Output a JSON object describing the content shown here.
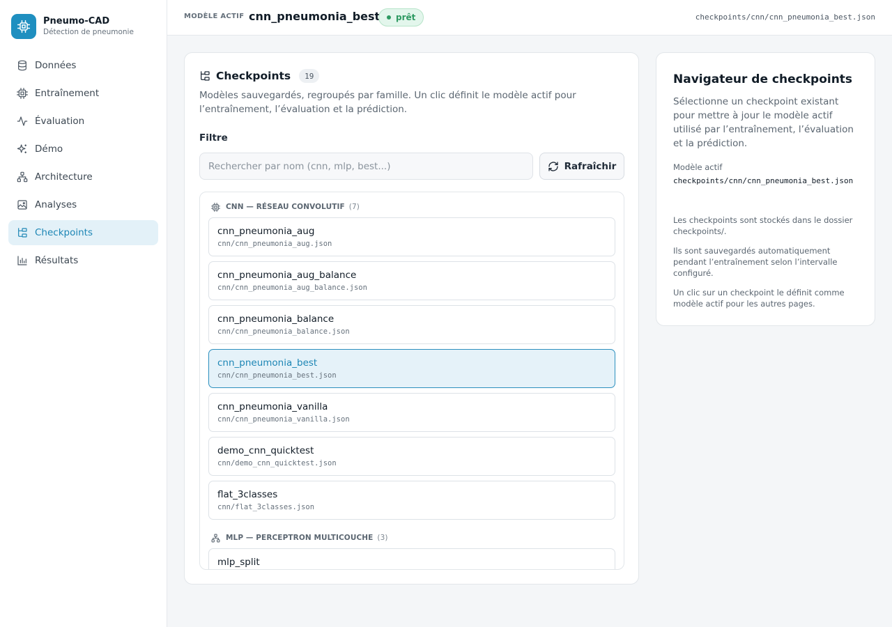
{
  "brand": {
    "name": "Pneumo-CAD",
    "subtitle": "Détection de pneumonie"
  },
  "nav": [
    {
      "label": "Données",
      "icon": "database-icon"
    },
    {
      "label": "Entraînement",
      "icon": "cpu-icon"
    },
    {
      "label": "Évaluation",
      "icon": "activity-icon"
    },
    {
      "label": "Démo",
      "icon": "sparkles-icon"
    },
    {
      "label": "Architecture",
      "icon": "network-icon"
    },
    {
      "label": "Analyses",
      "icon": "image-chart-icon"
    },
    {
      "label": "Checkpoints",
      "icon": "folder-tree-icon",
      "active": true
    },
    {
      "label": "Résultats",
      "icon": "bar-chart-icon"
    }
  ],
  "topbar": {
    "label": "MODÈLE ACTIF",
    "model_name": "cnn_pneumonia_best",
    "status": "prêt",
    "path": "checkpoints/cnn/cnn_pneumonia_best.json"
  },
  "main": {
    "title": "Checkpoints",
    "count": "19",
    "description": "Modèles sauvegardés, regroupés par famille. Un clic définit le modèle actif pour l’entraînement, l’évaluation et la prédiction.",
    "filter_label": "Filtre",
    "search_placeholder": "Rechercher par nom (cnn, mlp, best...)",
    "refresh_label": "Rafraîchir",
    "groups": [
      {
        "title": "CNN — RÉSEAU CONVOLUTIF",
        "count": "(7)",
        "icon": "cpu-icon",
        "items": [
          {
            "name": "cnn_pneumonia_aug",
            "file": "cnn/cnn_pneumonia_aug.json"
          },
          {
            "name": "cnn_pneumonia_aug_balance",
            "file": "cnn/cnn_pneumonia_aug_balance.json"
          },
          {
            "name": "cnn_pneumonia_balance",
            "file": "cnn/cnn_pneumonia_balance.json"
          },
          {
            "name": "cnn_pneumonia_best",
            "file": "cnn/cnn_pneumonia_best.json",
            "selected": true
          },
          {
            "name": "cnn_pneumonia_vanilla",
            "file": "cnn/cnn_pneumonia_vanilla.json"
          },
          {
            "name": "demo_cnn_quicktest",
            "file": "cnn/demo_cnn_quicktest.json"
          },
          {
            "name": "flat_3classes",
            "file": "cnn/flat_3classes.json"
          }
        ]
      },
      {
        "title": "MLP — PERCEPTRON MULTICOUCHE",
        "count": "(3)",
        "icon": "network-icon",
        "items": [
          {
            "name": "mlp_split",
            "file": ""
          }
        ]
      }
    ]
  },
  "side": {
    "title": "Navigateur de checkpoints",
    "description": "Sélectionne un checkpoint existant pour mettre à jour le modèle actif utilisé par l’entraînement, l’évaluation et la prédiction.",
    "active_label": "Modèle actif",
    "active_path": "checkpoints/cnn/cnn_pneumonia_best.json",
    "note1": "Les checkpoints sont stockés dans le dossier checkpoints/.",
    "note2": "Ils sont sauvegardés automatiquement pendant l’entraînement selon l’intervalle configuré.",
    "note3": "Un clic sur un checkpoint le définit comme modèle actif pour les autres pages."
  },
  "colors": {
    "accent": "#1d86b5",
    "status_green": "#2e9a62"
  }
}
